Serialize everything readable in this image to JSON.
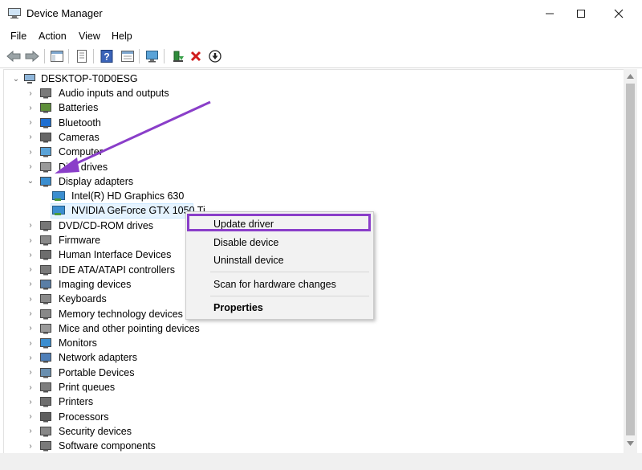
{
  "window": {
    "title": "Device Manager"
  },
  "menubar": [
    "File",
    "Action",
    "View",
    "Help"
  ],
  "tree": {
    "root": "DESKTOP-T0D0ESG",
    "items": [
      {
        "label": "Audio inputs and outputs",
        "icon": "speaker-icon"
      },
      {
        "label": "Batteries",
        "icon": "battery-icon"
      },
      {
        "label": "Bluetooth",
        "icon": "bluetooth-icon"
      },
      {
        "label": "Cameras",
        "icon": "camera-icon"
      },
      {
        "label": "Computer",
        "icon": "computer-icon"
      },
      {
        "label": "Disk drives",
        "icon": "disk-drive-icon"
      },
      {
        "label": "Display adapters",
        "icon": "display-adapter-icon"
      },
      {
        "label": "DVD/CD-ROM drives",
        "icon": "dvd-drive-icon"
      },
      {
        "label": "Firmware",
        "icon": "firmware-icon"
      },
      {
        "label": "Human Interface Devices",
        "icon": "hid-icon"
      },
      {
        "label": "IDE ATA/ATAPI controllers",
        "icon": "ide-controller-icon"
      },
      {
        "label": "Imaging devices",
        "icon": "imaging-icon"
      },
      {
        "label": "Keyboards",
        "icon": "keyboard-icon"
      },
      {
        "label": "Memory technology devices",
        "icon": "memory-icon"
      },
      {
        "label": "Mice and other pointing devices",
        "icon": "mouse-icon"
      },
      {
        "label": "Monitors",
        "icon": "monitor-icon"
      },
      {
        "label": "Network adapters",
        "icon": "network-adapter-icon"
      },
      {
        "label": "Portable Devices",
        "icon": "portable-device-icon"
      },
      {
        "label": "Print queues",
        "icon": "print-queue-icon"
      },
      {
        "label": "Printers",
        "icon": "printer-icon"
      },
      {
        "label": "Processors",
        "icon": "processor-icon"
      },
      {
        "label": "Security devices",
        "icon": "security-device-icon"
      },
      {
        "label": "Software components",
        "icon": "software-component-icon"
      }
    ],
    "display_children": [
      "Intel(R) HD Graphics 630",
      "NVIDIA GeForce GTX 1050 Ti"
    ]
  },
  "context_menu": {
    "update": "Update driver",
    "disable": "Disable device",
    "uninstall": "Uninstall device",
    "scan": "Scan for hardware changes",
    "properties": "Properties"
  },
  "colors": {
    "highlight_border": "#8a3ec9",
    "arrow": "#8a3ec9",
    "selection": "#e5f3ff"
  }
}
